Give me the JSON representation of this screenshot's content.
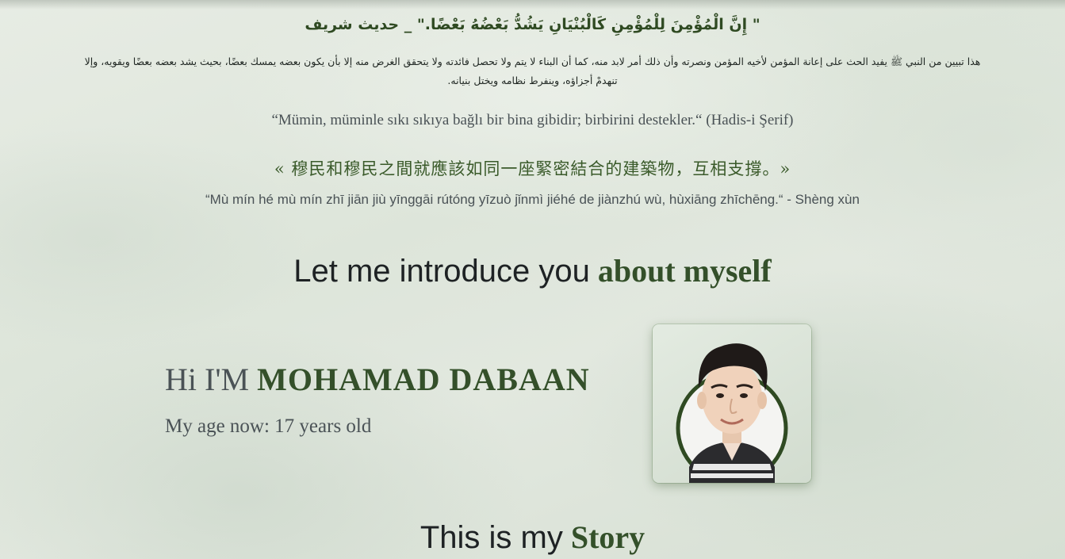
{
  "quotes": {
    "arabic_hadith": "\" إِنَّ الْمُؤْمِنَ لِلْمُؤْمِنِ كَالْبُنْيَانِ يَشُدُّ بَعْضُهُ بَعْضًا.\" _ حديث شريف",
    "arabic_explanation": "هذا تبيين من النبي ﷺ يفيد الحث على إعانة المؤمن لأخيه المؤمن ونصرته وأن ذلك أمر لابد منه، كما أن البناء لا يتم ولا تحصل فائدته ولا يتحقق الغرض منه إلا بأن يكون بعضه يمسك بعضًا، بحيث يشد بعضه بعضًا ويقويه، وإلا تنهدمْ أجزاؤه، وينفرط نظامه ويختل بنيانه.",
    "turkish": "“Mümin, müminle sıkı sıkıya bağlı bir bina gibidir; birbirini destekler.“ (Hadis-i Şerif)",
    "chinese": "« 穆民和穆民之間就應該如同一座緊密結合的建築物，互相支撐。»",
    "pinyin": "“Mù mín hé mù mín zhī jiān jiù yīnggāi rútóng yīzuò jǐnmì jiéhé de jiànzhú wù, hùxiāng zhīchēng.“ - Shèng xùn"
  },
  "intro": {
    "heading_light": "Let me introduce you",
    "heading_bold": "about myself"
  },
  "profile": {
    "greeting": "Hi I'M",
    "name": "MOHAMAD DABAAN",
    "age_text": "My age now: 17 years old"
  },
  "story": {
    "heading_light": "This is my",
    "heading_bold": "Story"
  },
  "colors": {
    "accent_green": "#34502a",
    "text_gray": "#4a5256"
  }
}
